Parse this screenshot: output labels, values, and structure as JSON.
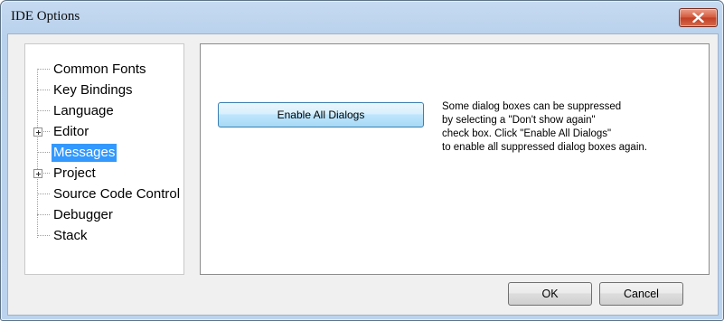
{
  "window": {
    "title": "IDE Options"
  },
  "tree": {
    "items": [
      {
        "label": "Common Fonts",
        "expandable": false,
        "selected": false
      },
      {
        "label": "Key Bindings",
        "expandable": false,
        "selected": false
      },
      {
        "label": "Language",
        "expandable": false,
        "selected": false
      },
      {
        "label": "Editor",
        "expandable": true,
        "selected": false
      },
      {
        "label": "Messages",
        "expandable": false,
        "selected": true
      },
      {
        "label": "Project",
        "expandable": true,
        "selected": false
      },
      {
        "label": "Source Code Control",
        "expandable": false,
        "selected": false
      },
      {
        "label": "Debugger",
        "expandable": false,
        "selected": false
      },
      {
        "label": "Stack",
        "expandable": false,
        "selected": false
      }
    ]
  },
  "panel": {
    "enable_button_label": "Enable All Dialogs",
    "description_lines": [
      "Some dialog boxes can be suppressed",
      "by selecting a \"Don't show  again\"",
      "check box. Click \"Enable All Dialogs\"",
      "to enable all suppressed dialog boxes again."
    ]
  },
  "footer": {
    "ok_label": "OK",
    "cancel_label": "Cancel"
  },
  "colors": {
    "selection": "#3399ff",
    "close_button": "#c13e24",
    "title_bar": "#b9d1ec"
  }
}
